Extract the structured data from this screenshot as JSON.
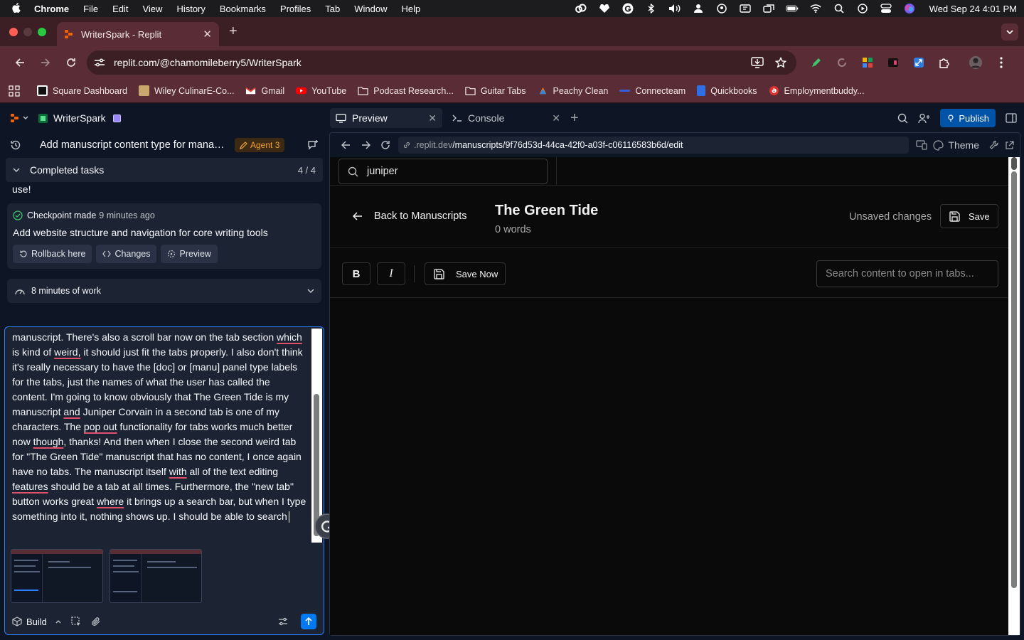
{
  "menubar": {
    "app": "Chrome",
    "menus": [
      "File",
      "Edit",
      "View",
      "History",
      "Bookmarks",
      "Profiles",
      "Tab",
      "Window",
      "Help"
    ],
    "clock": "Wed Sep 24  4:01 PM"
  },
  "browser": {
    "tab_title": "WriterSpark - Replit",
    "url": "replit.com/@chamomileberry5/WriterSpark",
    "bookmarks": [
      {
        "label": "Square Dashboard",
        "color": "#ffffff"
      },
      {
        "label": "Wiley CulinarE-Co...",
        "color": "#c9a66b"
      },
      {
        "label": "Gmail",
        "color": "#ea4335"
      },
      {
        "label": "YouTube",
        "color": "#ff0000"
      },
      {
        "label": "Podcast Research...",
        "color": "folder"
      },
      {
        "label": "Guitar Tabs",
        "color": "folder"
      },
      {
        "label": "Peachy Clean",
        "color": "#e67e22"
      },
      {
        "label": "Connecteam",
        "color": "#3b5bdb"
      },
      {
        "label": "Quickbooks",
        "color": "#2f6fe4"
      },
      {
        "label": "Employmentbuddy...",
        "color": "#e03131"
      }
    ]
  },
  "agent_panel": {
    "repl_name": "WriterSpark",
    "chat_title": "Add manuscript content type for managi...",
    "agent_badge": "Agent 3",
    "completed_tasks_label": "Completed tasks",
    "completed_tasks_count": "4 / 4",
    "cut_text": "use!",
    "checkpoint": {
      "label": "Checkpoint made",
      "time": "9 minutes ago",
      "title": "Add website structure and navigation for core writing tools",
      "rollback": "Rollback here",
      "changes": "Changes",
      "preview": "Preview"
    },
    "work_label": "8 minutes of work",
    "message_parts": [
      {
        "t": "manuscript. There's also a scroll bar now on the tab section ",
        "u": false
      },
      {
        "t": "which",
        "u": true
      },
      {
        "t": " is kind of ",
        "u": false
      },
      {
        "t": "weird,",
        "u": true
      },
      {
        "t": " it should just fit the tabs properly. I also don't think it's really necessary to have the [doc] or [manu] panel type labels for the tabs, just the names of what the user has called the content. I'm going to know obviously that The Green Tide is my manuscript ",
        "u": false
      },
      {
        "t": "and",
        "u": true
      },
      {
        "t": " Juniper Corvain in a second tab is one of my characters. The ",
        "u": false
      },
      {
        "t": "pop out",
        "u": true
      },
      {
        "t": " functionality for tabs works much better now ",
        "u": false
      },
      {
        "t": "though",
        "u": true
      },
      {
        "t": ", thanks! And then when I close the second weird tab for \"The Green Tide\" manuscript that has no content, I once again have no tabs. The manuscript itself ",
        "u": false
      },
      {
        "t": "with",
        "u": true
      },
      {
        "t": " all of the text editing ",
        "u": false
      },
      {
        "t": "features",
        "u": true
      },
      {
        "t": " should be a tab at all times. Furthermore, the \"new tab\" button works great ",
        "u": false
      },
      {
        "t": "where",
        "u": true
      },
      {
        "t": " it brings up a search bar, but when I type something into it, nothing shows up. I should be able to search",
        "u": false
      }
    ],
    "build_label": "Build"
  },
  "workspace": {
    "tabs": [
      {
        "label": "Preview",
        "icon": "monitor-icon"
      },
      {
        "label": "Console",
        "icon": "terminal-icon"
      }
    ],
    "publish_label": "Publish",
    "preview_url_domain": ".replit.dev",
    "preview_url_path": "/manuscripts/9f76d53d-44ca-42f0-a03f-c06116583b6d/edit",
    "theme_label": "Theme"
  },
  "app": {
    "search_value": "juniper",
    "back_label": "Back to Manuscripts",
    "doc_title": "The Green Tide",
    "word_count": "0 words",
    "unsaved_label": "Unsaved changes",
    "save_label": "Save",
    "bold_label": "B",
    "italic_label": "I",
    "save_now_label": "Save Now",
    "content_search_placeholder": "Search content to open in tabs..."
  }
}
